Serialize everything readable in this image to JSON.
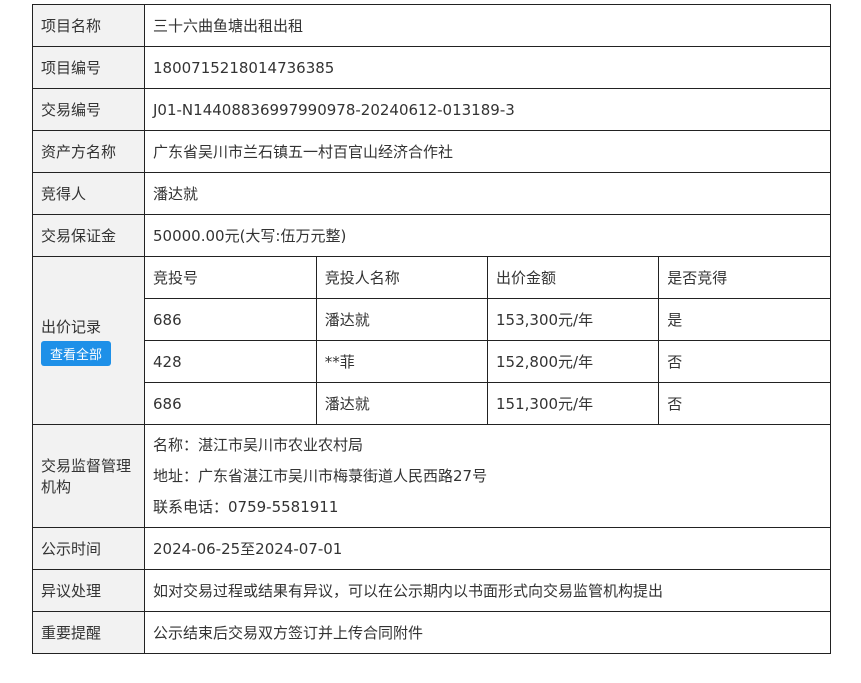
{
  "rows": {
    "project_name": {
      "label": "项目名称",
      "value": "三十六曲鱼塘出租出租"
    },
    "project_code": {
      "label": "项目编号",
      "value": "1800715218014736385"
    },
    "trade_code": {
      "label": "交易编号",
      "value": "J01-N14408836997990978-20240612-013189-3"
    },
    "owner": {
      "label": "资产方名称",
      "value": "广东省吴川市兰石镇五一村百官山经济合作社"
    },
    "winner": {
      "label": "竞得人",
      "value": "潘达就"
    },
    "deposit": {
      "label": "交易保证金",
      "value": "50000.00元(大写:伍万元整)"
    },
    "bids": {
      "label": "出价记录",
      "button": "查看全部",
      "headers": [
        "竞投号",
        "竞投人名称",
        "出价金额",
        "是否竞得"
      ],
      "items": [
        [
          "686",
          "潘达就",
          "153,300元/年",
          "是"
        ],
        [
          "428",
          "**菲",
          "152,800元/年",
          "否"
        ],
        [
          "686",
          "潘达就",
          "151,300元/年",
          "否"
        ]
      ]
    },
    "supervisor": {
      "label": "交易监督管理机构",
      "lines": [
        "名称：湛江市吴川市农业农村局",
        "地址：广东省湛江市吴川市梅菉街道人民西路27号",
        "联系电话：0759-5581911"
      ]
    },
    "publicity": {
      "label": "公示时间",
      "value": "2024-06-25至2024-07-01"
    },
    "objection": {
      "label": "异议处理",
      "value": "如对交易过程或结果有异议，可以在公示期内以书面形式向交易监管机构提出"
    },
    "reminder": {
      "label": "重要提醒",
      "value": "公示结束后交易双方签订并上传合同附件"
    }
  }
}
